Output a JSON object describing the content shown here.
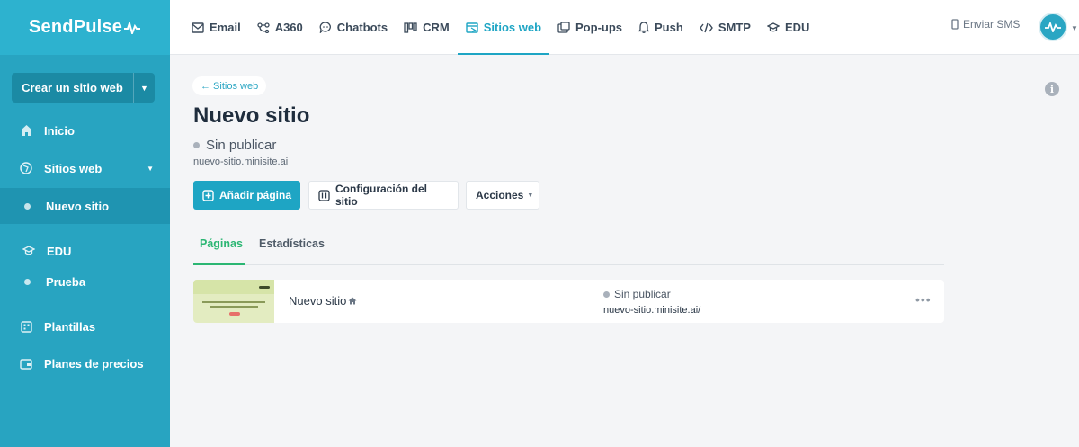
{
  "brand": {
    "name": "SendPulse"
  },
  "sidebar": {
    "create_button": "Crear un sitio web",
    "items": [
      {
        "label": "Inicio",
        "icon": "home-icon"
      },
      {
        "label": "Sitios web",
        "icon": "globe-icon"
      },
      {
        "label": "Nuevo sitio",
        "icon": "dot"
      },
      {
        "label": "EDU",
        "icon": "graduation-cap-icon"
      },
      {
        "label": "Prueba",
        "icon": "dot"
      },
      {
        "label": "Plantillas",
        "icon": "templates-icon"
      },
      {
        "label": "Planes de precios",
        "icon": "wallet-icon"
      }
    ]
  },
  "topnav": {
    "items": [
      {
        "label": "Email",
        "icon": "mail-icon"
      },
      {
        "label": "A360",
        "icon": "flow-icon"
      },
      {
        "label": "Chatbots",
        "icon": "chat-icon"
      },
      {
        "label": "CRM",
        "icon": "crm-icon"
      },
      {
        "label": "Sitios web",
        "icon": "website-icon"
      },
      {
        "label": "Pop-ups",
        "icon": "popup-icon"
      },
      {
        "label": "Push",
        "icon": "bell-icon"
      },
      {
        "label": "SMTP",
        "icon": "code-icon"
      },
      {
        "label": "EDU",
        "icon": "graduation-cap-icon"
      }
    ],
    "sms": "Enviar SMS"
  },
  "main": {
    "breadcrumb": "← Sitios web",
    "title": "Nuevo sitio",
    "status": "Sin publicar",
    "url": "nuevo-sitio.minisite.ai",
    "buttons": {
      "add_page": "Añadir página",
      "settings": "Configuración del sitio",
      "actions": "Acciones"
    },
    "tabs": [
      "Páginas",
      "Estadísticas"
    ],
    "rows": [
      {
        "name": "Nuevo sitio",
        "status": "Sin publicar",
        "url": "nuevo-sitio.minisite.ai/"
      }
    ]
  },
  "colors": {
    "sidebar": "#28a4c1",
    "accent": "#1ea5c4",
    "tab_active": "#2bb673"
  }
}
